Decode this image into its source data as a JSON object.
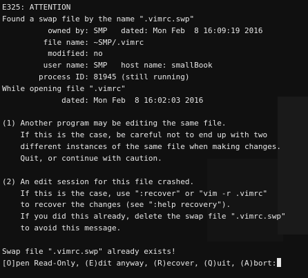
{
  "terminal": {
    "lines": [
      "E325: ATTENTION",
      "Found a swap file by the name \".vimrc.swp\"",
      "          owned by: SMP   dated: Mon Feb  8 16:09:19 2016",
      "         file name: ~SMP/.vimrc",
      "          modified: no",
      "         user name: SMP   host name: smallBook",
      "        process ID: 81945 (still running)",
      "While opening file \".vimrc\"",
      "             dated: Mon Feb  8 16:02:03 2016",
      "",
      "(1) Another program may be editing the same file.",
      "    If this is the case, be careful not to end up with two",
      "    different instances of the same file when making changes.",
      "    Quit, or continue with caution.",
      "",
      "(2) An edit session for this file crashed.",
      "    If this is the case, use \":recover\" or \"vim -r .vimrc\"",
      "    to recover the changes (see \":help recovery\").",
      "    If you did this already, delete the swap file \".vimrc.swp\"",
      "    to avoid this message.",
      "",
      "Swap file \".vimrc.swp\" already exists!",
      "[O]pen Read-Only, (E)dit anyway, (R)ecover, (Q)uit, (A)bort:"
    ]
  }
}
